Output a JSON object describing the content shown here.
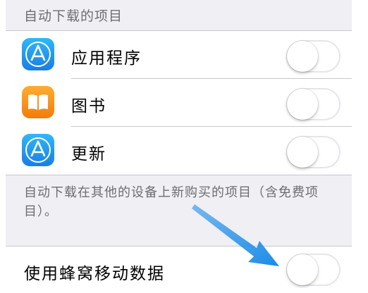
{
  "section_header": "自动下载的项目",
  "auto_download_items": [
    {
      "label": "应用程序",
      "icon": "app-store-icon",
      "enabled": false
    },
    {
      "label": "图书",
      "icon": "books-icon",
      "enabled": false
    },
    {
      "label": "更新",
      "icon": "app-store-icon",
      "enabled": false
    }
  ],
  "footnote": "自动下载在其他的设备上新购买的项目（含免费项目）。",
  "cellular": {
    "label": "使用蜂窝移动数据",
    "enabled": false
  },
  "colors": {
    "accent": "#1a8be8",
    "background": "#efeff4",
    "separator": "#c8c7cc"
  }
}
